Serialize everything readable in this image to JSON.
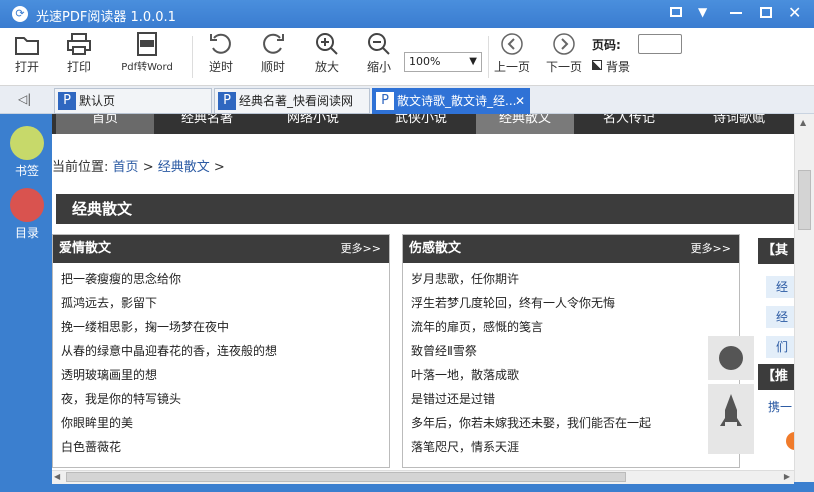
{
  "window": {
    "title": "光速PDF阅读器 1.0.0.1"
  },
  "toolbar": {
    "open": "打开",
    "print": "打印",
    "pdf2word": "Pdf转Word",
    "undo": "逆时",
    "redo": "顺时",
    "zoom_in": "放大",
    "zoom_out": "缩小",
    "zoom_value": "100%",
    "prev_page": "上一页",
    "next_page": "下一页",
    "page_label": "页码:",
    "background": "背景"
  },
  "tabs": [
    {
      "label": "默认页"
    },
    {
      "label": "经典名著_快看阅读网"
    },
    {
      "label": "散文诗歌_散文诗_经..."
    }
  ],
  "sidebar": {
    "bookmarks": "书签",
    "toc": "目录"
  },
  "nav": [
    "首页",
    "经典名著",
    "网络小说",
    "武侠小说",
    "经典散文",
    "名人传记",
    "诗词歌赋"
  ],
  "breadcrumb": {
    "prefix": "当前位置:",
    "home": "首页",
    "sep": ">",
    "section": "经典散文",
    "trail": ">"
  },
  "section_title": "经典散文",
  "panels": [
    {
      "title": "爱情散文",
      "more": "更多>>",
      "items": [
        "把一袭瘦瘦的思念给你",
        "孤鸿远去，影留下",
        "挽一缕相思影，掬一场梦在夜中",
        "从春的绿意中晶迎春花的香，连夜般的想",
        "透明玻璃画里的想",
        "夜，我是你的特写镜头",
        "你眼眸里的美",
        "白色蔷薇花"
      ]
    },
    {
      "title": "伤感散文",
      "more": "更多>>",
      "items": [
        "岁月悲歌，任你期许",
        "浮生若梦几度轮回，终有一人令你无悔",
        "流年的扉页，感慨的笺言",
        "致曾经Ⅱ雪祭",
        "叶落一地，散落成歌",
        "是错过还是过错",
        "多年后，你若未嫁我还未娶，我们能否在一起",
        "落笔咫尺，情系天涯"
      ]
    }
  ],
  "right_panels": {
    "other": "【其",
    "recommend": "【推",
    "links": [
      "经",
      "经",
      "们"
    ],
    "bottom_link": "携一"
  }
}
